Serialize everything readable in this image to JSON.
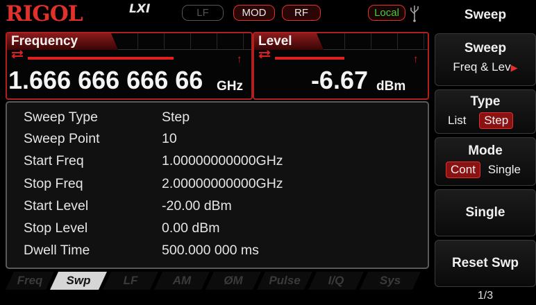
{
  "status": {
    "brand": "RIGOL",
    "lxi": "LXI",
    "indicators": {
      "lf": "LF",
      "mod": "MOD",
      "rf": "RF",
      "local": "Local"
    }
  },
  "frequency": {
    "label": "Frequency",
    "value": "1.666 666 666 66",
    "unit": "GHz"
  },
  "level": {
    "label": "Level",
    "value": "-6.67",
    "unit": "dBm"
  },
  "params": [
    {
      "label": "Sweep Type",
      "value": "Step"
    },
    {
      "label": "Sweep Point",
      "value": "10"
    },
    {
      "label": "Start Freq",
      "value": "1.00000000000GHz"
    },
    {
      "label": "Stop Freq",
      "value": "2.00000000000GHz"
    },
    {
      "label": "Start Level",
      "value": "-20.00 dBm"
    },
    {
      "label": "Stop Level",
      "value": "0.00 dBm"
    },
    {
      "label": "Dwell Time",
      "value": "500.000 000 ms"
    }
  ],
  "tabs": [
    {
      "label": "Freq",
      "active": false
    },
    {
      "label": "Swp",
      "active": true
    },
    {
      "label": "LF",
      "active": false
    },
    {
      "label": "AM",
      "active": false
    },
    {
      "label": "ØM",
      "active": false
    },
    {
      "label": "Pulse",
      "active": false
    },
    {
      "label": "I/Q",
      "active": false
    },
    {
      "label": "Sys",
      "active": false
    }
  ],
  "softkeys": {
    "title": "Sweep",
    "sweep": {
      "title": "Sweep",
      "value": "Freq & Lev"
    },
    "type": {
      "title": "Type",
      "opt1": "List",
      "opt2": "Step",
      "selected": "Step"
    },
    "mode": {
      "title": "Mode",
      "opt1": "Cont",
      "opt2": "Single",
      "selected": "Cont"
    },
    "single": "Single",
    "reset": "Reset Swp",
    "page": "1/3"
  },
  "colors": {
    "accent": "#e0312a",
    "local": "#3cd03c"
  }
}
